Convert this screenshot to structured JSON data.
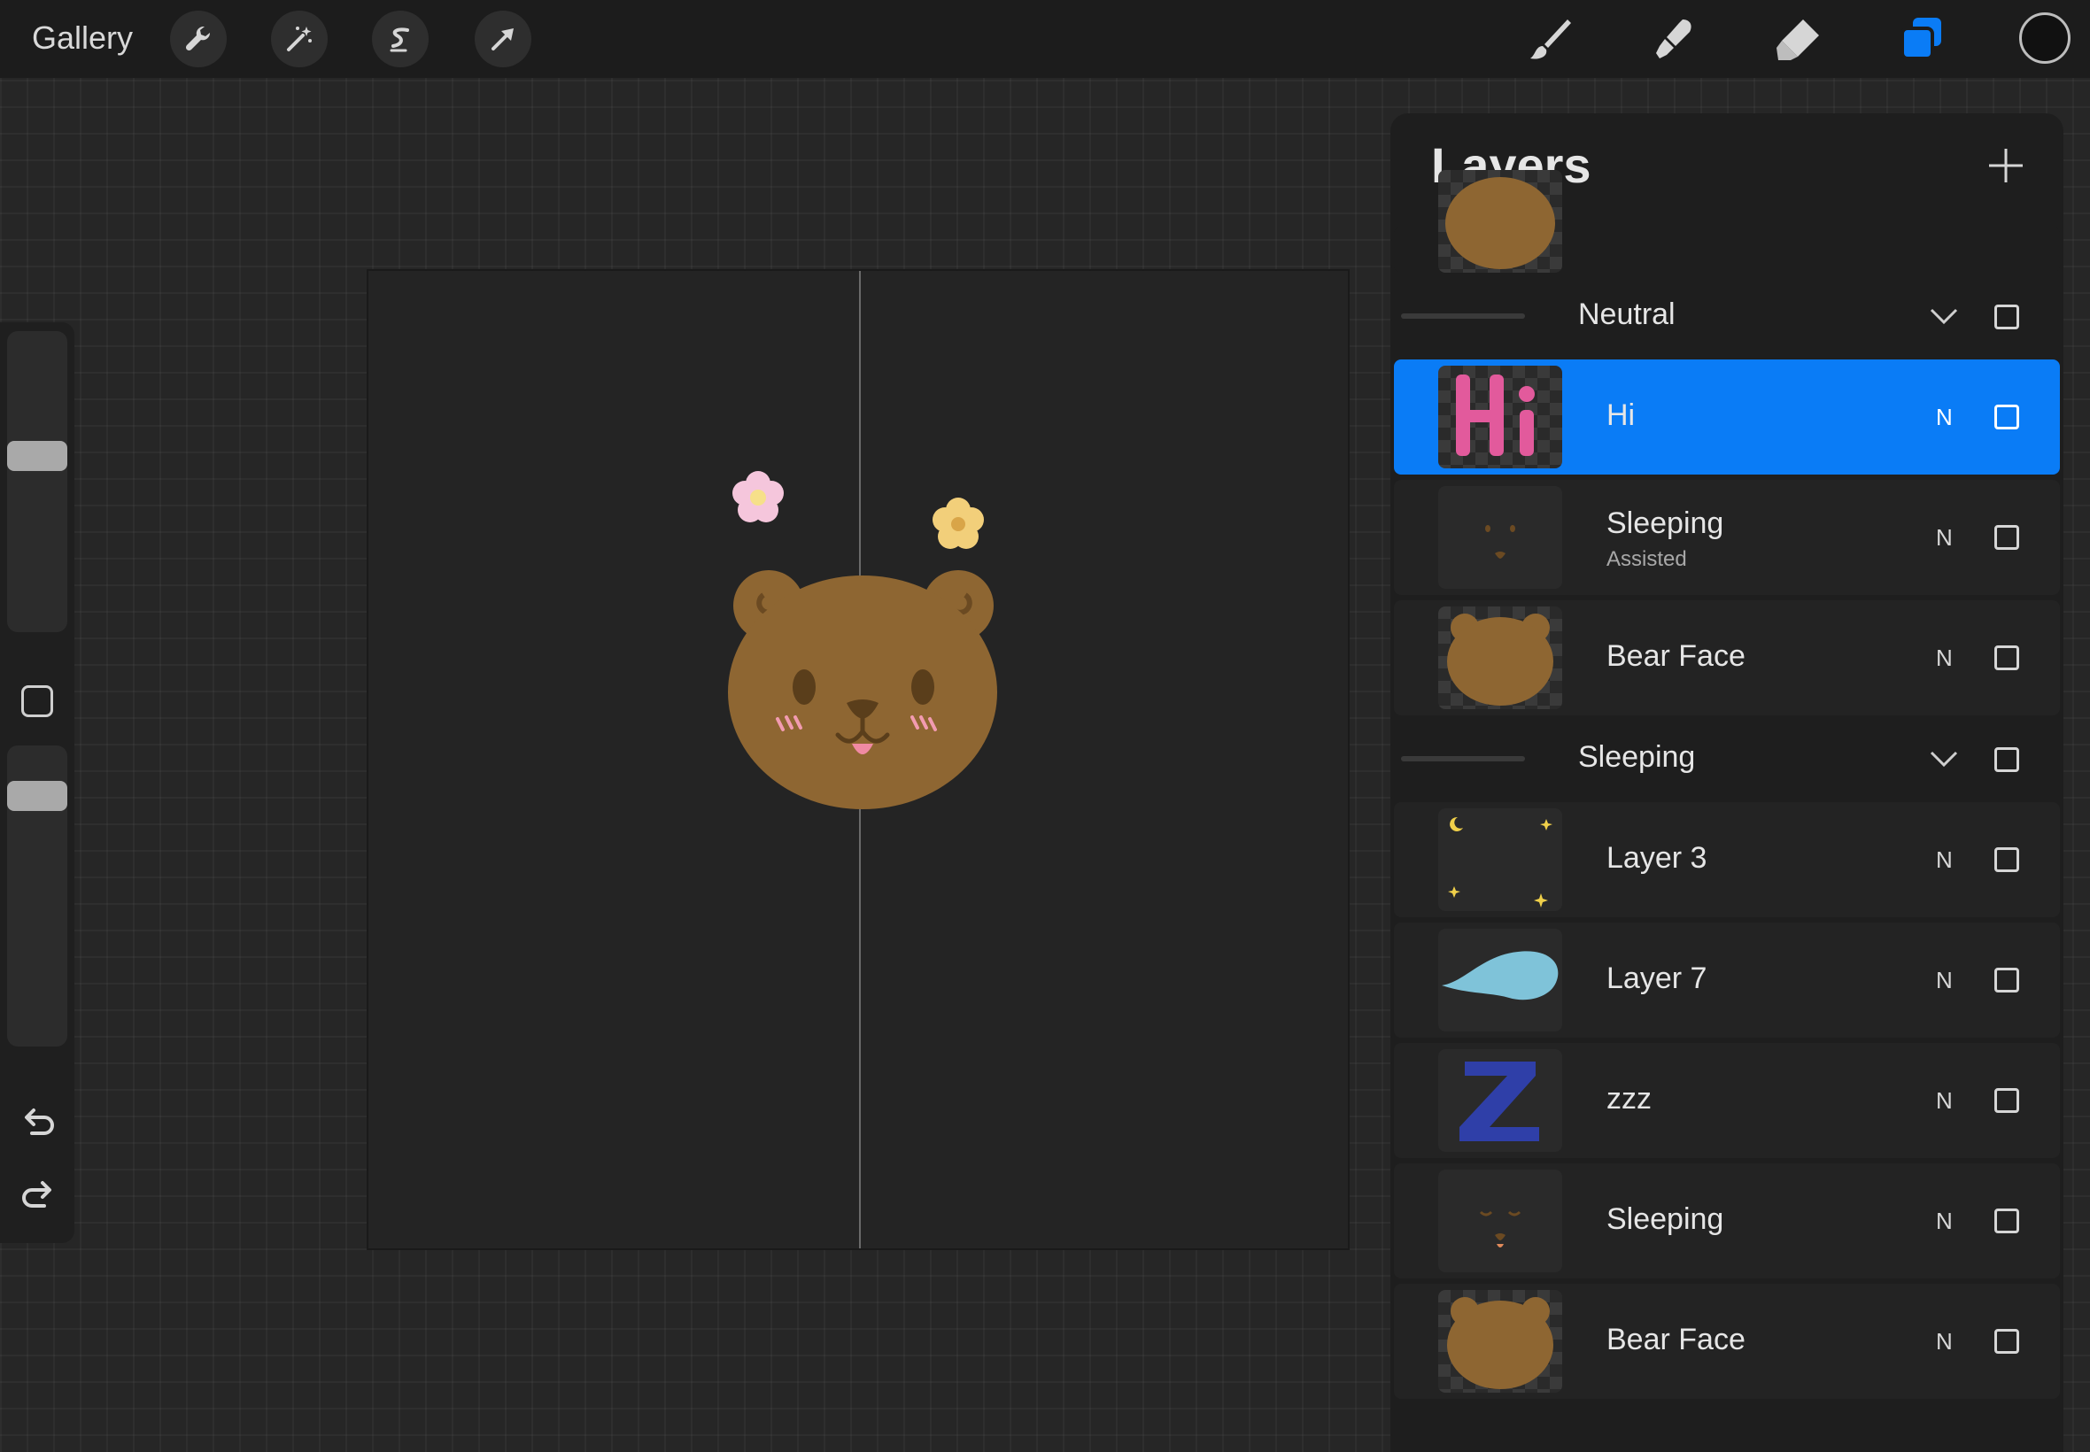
{
  "topbar": {
    "gallery_label": "Gallery",
    "left_tools": [
      "wrench-icon",
      "magic-wand-icon",
      "selection-icon",
      "transform-arrow-icon"
    ],
    "right_tools": [
      "brush-icon",
      "smudge-icon",
      "eraser-icon",
      "layers-icon"
    ],
    "active_tool": "layers-icon",
    "current_color": "#111111",
    "accent_color": "#0a7cf6"
  },
  "sidebar": {
    "brush_size_level": 0.73,
    "opacity_level": 0.87
  },
  "layers": {
    "title": "Layers",
    "groups": [
      {
        "name": "Neutral",
        "layers": [
          {
            "name": "Hi",
            "blend": "N",
            "selected": true
          },
          {
            "name": "Sleeping",
            "sub": "Assisted",
            "blend": "N"
          },
          {
            "name": "Bear Face",
            "blend": "N"
          }
        ]
      },
      {
        "name": "Sleeping",
        "layers": [
          {
            "name": "Layer 3",
            "blend": "N"
          },
          {
            "name": "Layer 7",
            "blend": "N"
          },
          {
            "name": "zzz",
            "blend": "N"
          },
          {
            "name": "Sleeping",
            "blend": "N"
          },
          {
            "name": "Bear Face",
            "blend": "N"
          }
        ]
      }
    ]
  }
}
